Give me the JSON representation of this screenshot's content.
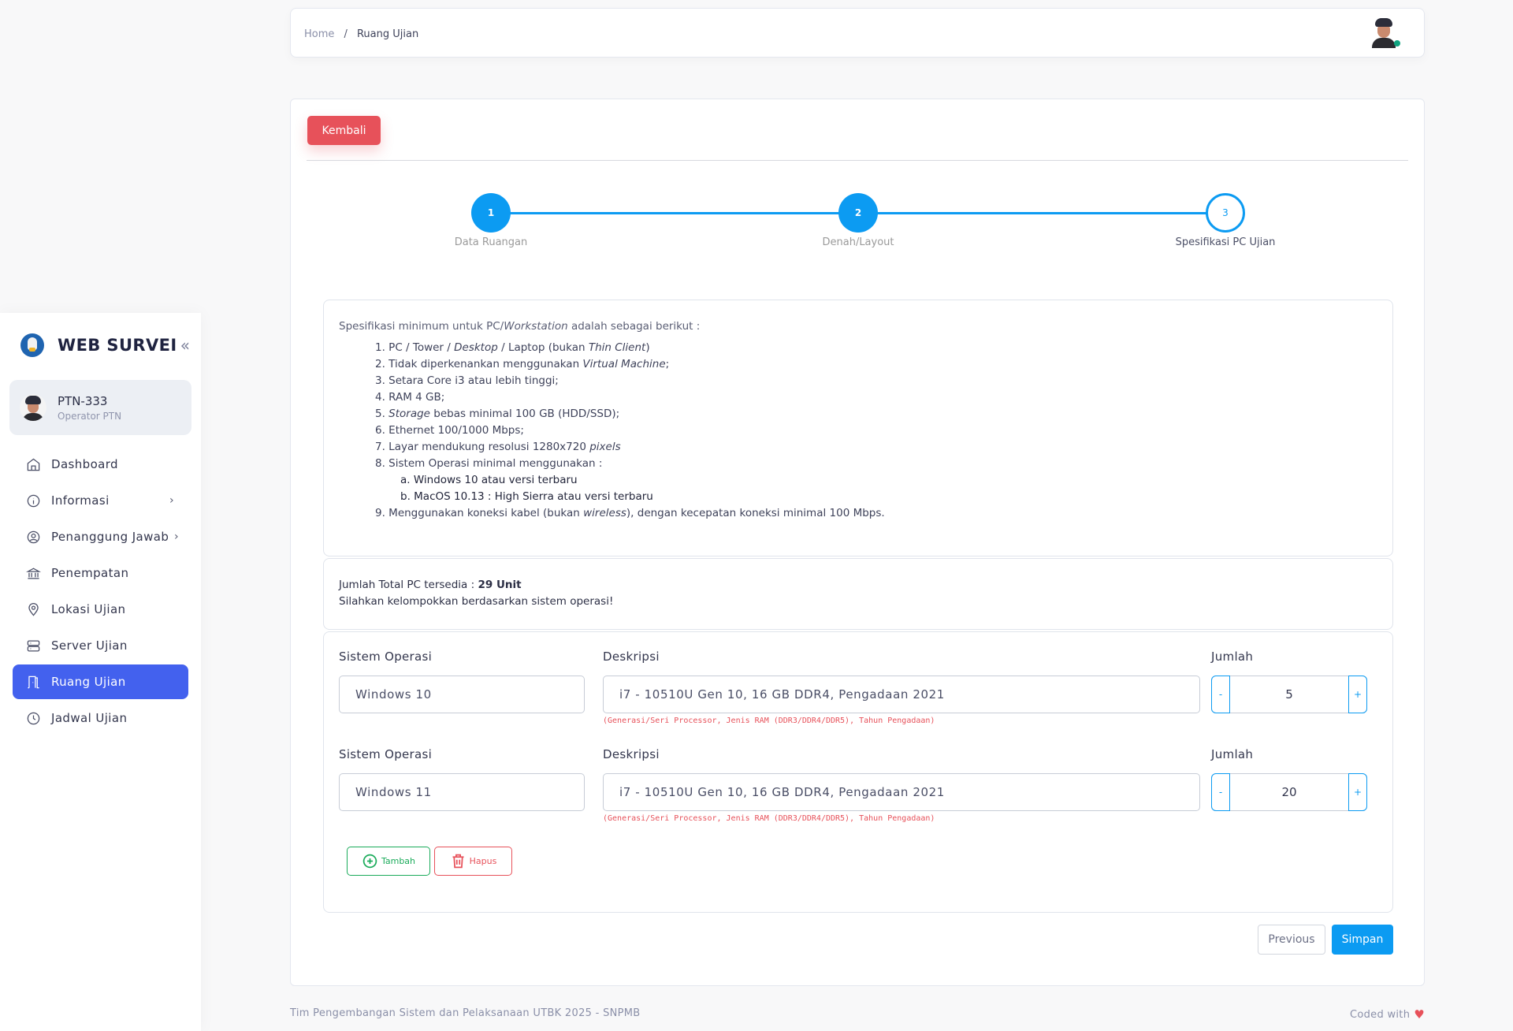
{
  "sidebar": {
    "brand_title": "WEB SURVEI",
    "collapse_icon": "double-chevron-left-icon",
    "user": {
      "name": "PTN-333",
      "role": "Operator PTN"
    },
    "items": [
      {
        "label": "Dashboard",
        "icon": "home-icon",
        "has_submenu": false,
        "active": false
      },
      {
        "label": "Informasi",
        "icon": "info-icon",
        "has_submenu": true,
        "active": false
      },
      {
        "label": "Penanggung Jawab",
        "icon": "user-circle-icon",
        "has_submenu": true,
        "active": false
      },
      {
        "label": "Penempatan",
        "icon": "bank-icon",
        "has_submenu": false,
        "active": false
      },
      {
        "label": "Lokasi Ujian",
        "icon": "map-pin-icon",
        "has_submenu": false,
        "active": false
      },
      {
        "label": "Server Ujian",
        "icon": "server-icon",
        "has_submenu": false,
        "active": false
      },
      {
        "label": "Ruang Ujian",
        "icon": "door-icon",
        "has_submenu": false,
        "active": true
      },
      {
        "label": "Jadwal Ujian",
        "icon": "clock-icon",
        "has_submenu": false,
        "active": false
      }
    ]
  },
  "breadcrumb": {
    "home": "Home",
    "separator": "/",
    "current": "Ruang Ujian"
  },
  "main": {
    "back_label": "Kembali",
    "steps": [
      {
        "number": "1",
        "label": "Data Ruangan",
        "state": "completed"
      },
      {
        "number": "2",
        "label": "Denah/Layout",
        "state": "completed"
      },
      {
        "number": "3",
        "label": "Spesifikasi PC Ujian",
        "state": "current"
      }
    ],
    "spec": {
      "intro_prefix": "Spesifikasi minimum untuk PC/",
      "intro_italic": "Workstation",
      "intro_suffix": " adalah sebagai berikut :",
      "items": [
        {
          "n": "1.",
          "parts": [
            [
              "PC / Tower / ",
              false
            ],
            [
              "Desktop",
              true
            ],
            [
              " / Laptop (bukan ",
              false
            ],
            [
              "Thin Client",
              true
            ],
            [
              ")",
              false
            ]
          ]
        },
        {
          "n": "2.",
          "parts": [
            [
              "Tidak diperkenankan menggunakan ",
              false
            ],
            [
              "Virtual Machine",
              true
            ],
            [
              ";",
              false
            ]
          ]
        },
        {
          "n": "3.",
          "parts": [
            [
              "Setara Core i3 atau lebih tinggi;",
              false
            ]
          ]
        },
        {
          "n": "4.",
          "parts": [
            [
              "RAM 4 GB;",
              false
            ]
          ]
        },
        {
          "n": "5.",
          "parts": [
            [
              "Storage",
              true
            ],
            [
              " bebas minimal 100 GB (HDD/SSD);",
              false
            ]
          ]
        },
        {
          "n": "6.",
          "parts": [
            [
              "Ethernet 100/1000 Mbps;",
              false
            ]
          ]
        },
        {
          "n": "7.",
          "parts": [
            [
              "Layar mendukung resolusi 1280x720 ",
              false
            ],
            [
              "pixels",
              true
            ]
          ]
        },
        {
          "n": "8.",
          "parts": [
            [
              "Sistem Operasi minimal menggunakan :",
              false
            ]
          ]
        },
        {
          "n": "9.",
          "parts": [
            [
              "Menggunakan koneksi kabel (bukan ",
              false
            ],
            [
              "wireless",
              true
            ],
            [
              "), dengan kecepatan koneksi minimal 100 Mbps.",
              false
            ]
          ]
        }
      ],
      "os_sub_items": [
        {
          "n": "a.",
          "text": "Windows 10 atau versi terbaru"
        },
        {
          "n": "b.",
          "text": "MacOS 10.13 : High Sierra atau versi terbaru"
        }
      ]
    },
    "total": {
      "label": "Jumlah Total PC tersedia : ",
      "value": "29 Unit",
      "instruction": "Silahkan kelompokkan berdasarkan sistem operasi!"
    },
    "form": {
      "os_label": "Sistem Operasi",
      "desc_label": "Deskripsi",
      "qty_label": "Jumlah",
      "desc_hint": "(Generasi/Seri Processor, Jenis RAM (DDR3/DDR4/DDR5), Tahun Pengadaan)",
      "minus": "-",
      "plus": "+",
      "rows": [
        {
          "os": "Windows 10",
          "desc": "i7 - 10510U Gen 10, 16 GB DDR4, Pengadaan 2021",
          "qty": "5"
        },
        {
          "os": "Windows 11",
          "desc": "i7 - 10510U Gen 10, 16 GB DDR4, Pengadaan 2021",
          "qty": "20"
        }
      ],
      "add_label": "Tambah",
      "delete_label": "Hapus"
    },
    "previous_label": "Previous",
    "save_label": "Simpan"
  },
  "footer": {
    "left": "Tim Pengembangan Sistem dan Pelaksanaan UTBK 2025 - SNPMB",
    "right": "Coded with",
    "heart": "♥"
  },
  "colors": {
    "primary": "#0c9bf2",
    "active_nav": "#4361ee",
    "danger": "#e7515a",
    "success": "#1aab5a",
    "online_status": "#10a37f"
  }
}
